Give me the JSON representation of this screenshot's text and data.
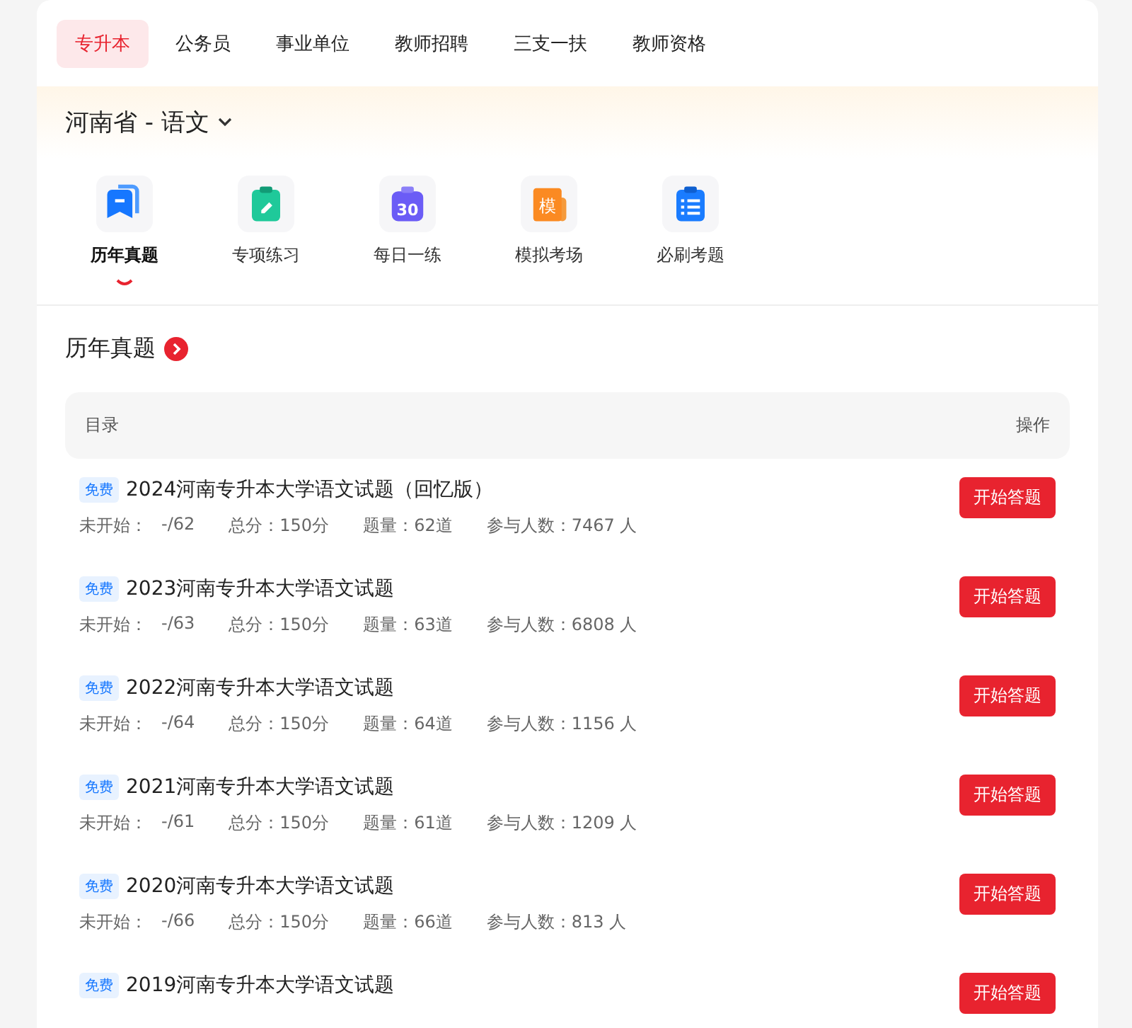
{
  "tabs": [
    {
      "label": "专升本",
      "selected": true
    },
    {
      "label": "公务员",
      "selected": false
    },
    {
      "label": "事业单位",
      "selected": false
    },
    {
      "label": "教师招聘",
      "selected": false
    },
    {
      "label": "三支一扶",
      "selected": false
    },
    {
      "label": "教师资格",
      "selected": false
    }
  ],
  "region": {
    "label": "河南省 - 语文"
  },
  "categories": [
    {
      "label": "历年真题",
      "kind": "bookmark",
      "selected": true
    },
    {
      "label": "专项练习",
      "kind": "pen-clipboard",
      "selected": false
    },
    {
      "label": "每日一练",
      "kind": "calendar",
      "icon_text": "30",
      "selected": false
    },
    {
      "label": "模拟考场",
      "kind": "document",
      "icon_text": "模",
      "selected": false
    },
    {
      "label": "必刷考题",
      "kind": "checklist",
      "selected": false
    }
  ],
  "section": {
    "title": "历年真题"
  },
  "table": {
    "columns": [
      "目录",
      "操作"
    ],
    "rows": [
      {
        "badge": "免费",
        "title": "2024河南专升本大学语文试题（回忆版）",
        "status": "未开始：",
        "progress": "-/62",
        "score": "总分：150分",
        "count": "题量：62道",
        "participants": "参与人数：7467 人",
        "action": "开始答题"
      },
      {
        "badge": "免费",
        "title": "2023河南专升本大学语文试题",
        "status": "未开始：",
        "progress": "-/63",
        "score": "总分：150分",
        "count": "题量：63道",
        "participants": "参与人数：6808 人",
        "action": "开始答题"
      },
      {
        "badge": "免费",
        "title": "2022河南专升本大学语文试题",
        "status": "未开始：",
        "progress": "-/64",
        "score": "总分：150分",
        "count": "题量：64道",
        "participants": "参与人数：1156 人",
        "action": "开始答题"
      },
      {
        "badge": "免费",
        "title": "2021河南专升本大学语文试题",
        "status": "未开始：",
        "progress": "-/61",
        "score": "总分：150分",
        "count": "题量：61道",
        "participants": "参与人数：1209 人",
        "action": "开始答题"
      },
      {
        "badge": "免费",
        "title": "2020河南专升本大学语文试题",
        "status": "未开始：",
        "progress": "-/66",
        "score": "总分：150分",
        "count": "题量：66道",
        "participants": "参与人数：813 人",
        "action": "开始答题"
      },
      {
        "badge": "免费",
        "title": "2019河南专升本大学语文试题",
        "action": "开始答题"
      }
    ]
  }
}
